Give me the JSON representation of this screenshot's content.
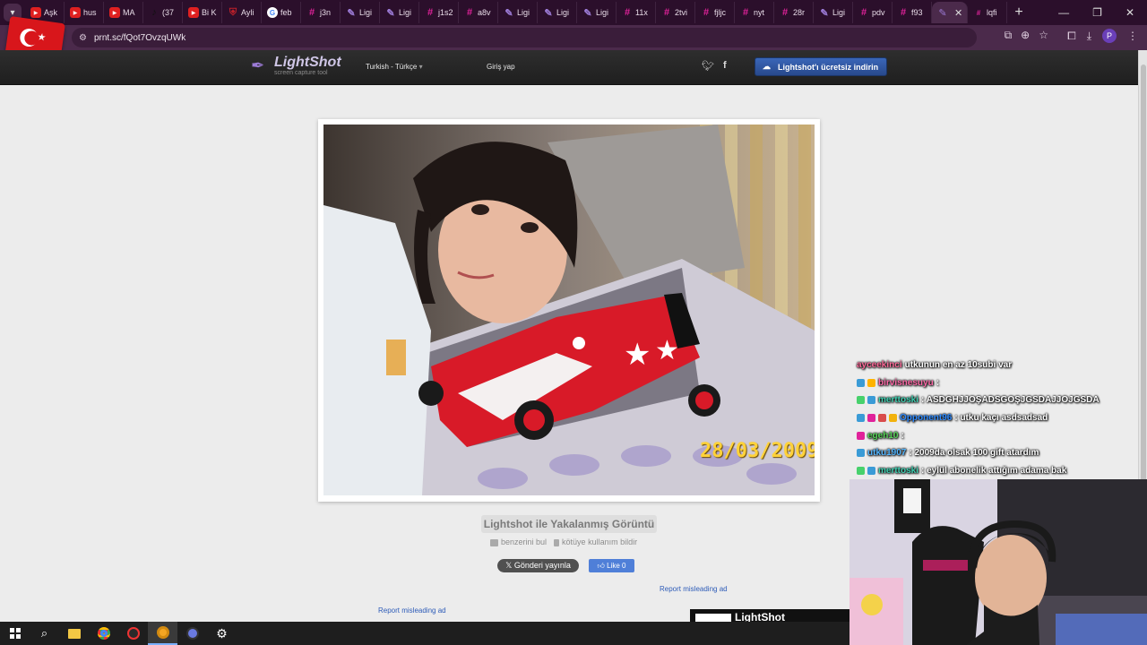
{
  "browser": {
    "tabs": [
      {
        "label": "Aşk",
        "icon": "youtube-icon",
        "color": "#e02020"
      },
      {
        "label": "hus",
        "icon": "youtube-icon",
        "color": "#e02020"
      },
      {
        "label": "MA",
        "icon": "youtube-icon",
        "color": "#e02020"
      },
      {
        "label": "(37",
        "icon": "tiktok-icon",
        "color": "#111111"
      },
      {
        "label": "Bi K",
        "icon": "youtube-icon",
        "color": "#e02020"
      },
      {
        "label": "Ayli",
        "icon": "shield-icon",
        "color": "#c0202a"
      },
      {
        "label": "feb",
        "icon": "google-icon",
        "color": "#ffffff"
      },
      {
        "label": "j3n",
        "icon": "hashtag-icon",
        "color": "#e0229a"
      },
      {
        "label": "Ligi",
        "icon": "lightshot-icon",
        "color": "#9c7bd6"
      },
      {
        "label": "Ligi",
        "icon": "lightshot-icon",
        "color": "#9c7bd6"
      },
      {
        "label": "j1s2",
        "icon": "hashtag-icon",
        "color": "#e0229a"
      },
      {
        "label": "a8v",
        "icon": "hashtag-icon",
        "color": "#e0229a"
      },
      {
        "label": "Ligi",
        "icon": "lightshot-icon",
        "color": "#9c7bd6"
      },
      {
        "label": "Ligi",
        "icon": "lightshot-icon",
        "color": "#9c7bd6"
      },
      {
        "label": "Ligi",
        "icon": "lightshot-icon",
        "color": "#9c7bd6"
      },
      {
        "label": "11x",
        "icon": "hashtag-icon",
        "color": "#e0229a"
      },
      {
        "label": "2tvi",
        "icon": "hashtag-icon",
        "color": "#e0229a"
      },
      {
        "label": "fjljc",
        "icon": "hashtag-icon",
        "color": "#e0229a"
      },
      {
        "label": "nyt",
        "icon": "hashtag-icon",
        "color": "#e0229a"
      },
      {
        "label": "28r",
        "icon": "hashtag-icon",
        "color": "#e0229a"
      },
      {
        "label": "Ligi",
        "icon": "lightshot-icon",
        "color": "#9c7bd6"
      },
      {
        "label": "pdv",
        "icon": "hashtag-icon",
        "color": "#e0229a"
      },
      {
        "label": "f93",
        "icon": "hashtag-icon",
        "color": "#e0229a"
      }
    ],
    "active_tab": {
      "icon": "lightshot-icon",
      "label": ""
    },
    "after_tab": {
      "label": "lqfi",
      "icon": "hashtag-icon"
    },
    "url": "prnt.sc/fQot7OvzqUWk",
    "profile_initial": "P"
  },
  "site": {
    "logo_title": "LightShot",
    "logo_subtitle": "screen capture tool",
    "language": "Turkish - Türkçe",
    "login": "Giriş yap",
    "download_button": "Lightshot'ı ücretsiz indirin",
    "photo_date_stamp": "28/03/2009",
    "caption": "Lightshot ile Yakalanmış Görüntü",
    "find_similar": "benzerini bul",
    "report_abuse": "kötüye kullanım bildir",
    "share_x": "Gönderi yayınla",
    "like": "Like 0",
    "report_ad": "Report misleading ad",
    "ad_text": "LightShot"
  },
  "chat": [
    {
      "user": "ayceekinci",
      "user_color": "#ff6a9a",
      "message": "utkunun en az 10subi var",
      "badges": []
    },
    {
      "user": "birvisnesuyu",
      "user_color": "#ff6aa8",
      "message": ":",
      "badges": [
        "#3a9bd6",
        "#ffb300"
      ]
    },
    {
      "user": "merttoski",
      "user_color": "#3ecfb0",
      "message": ": ASDGHJJOŞADSGOŞJGSDAJJOJGSDA",
      "badges": [
        "#47d16c",
        "#3a9bd6"
      ]
    },
    {
      "user": "Opponent96",
      "user_color": "#2f8bff",
      "message": ": utku kaçı asdsadsad",
      "badges": [
        "#3a9bd6",
        "#e0229a",
        "#d94c4c",
        "#f2b20c"
      ]
    },
    {
      "user": "egeh10",
      "user_color": "#58d65a",
      "message": ":",
      "badges": [
        "#e0229a"
      ]
    },
    {
      "user": "utku1907",
      "user_color": "#52b6ff",
      "message": ": 2009da olsak 100 gift atardım",
      "badges": [
        "#3a9bd6"
      ]
    },
    {
      "user": "merttoski",
      "user_color": "#3ecfb0",
      "message": ": eylül abonelik attığım adama bak",
      "badges": [
        "#47d16c",
        "#3a9bd6"
      ]
    }
  ],
  "colors": {
    "accent_blue": "#2e5cb8",
    "header_bg": "#262626",
    "browser_frame": "#4b2a4b"
  }
}
